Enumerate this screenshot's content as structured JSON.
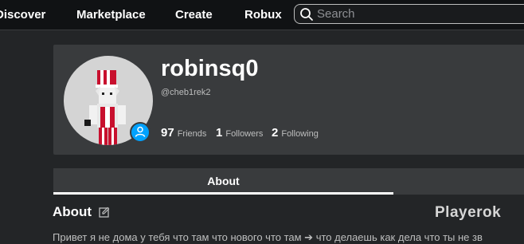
{
  "nav": {
    "discover": "Discover",
    "marketplace": "Marketplace",
    "create": "Create",
    "robux": "Robux"
  },
  "search": {
    "placeholder": "Search"
  },
  "profile": {
    "username": "robinsq0",
    "handle": "@cheb1rek2",
    "stats": [
      {
        "count": "97",
        "label": "Friends"
      },
      {
        "count": "1",
        "label": "Followers"
      },
      {
        "count": "2",
        "label": "Following"
      }
    ]
  },
  "tabs": {
    "about": "About"
  },
  "about": {
    "heading": "About",
    "text": "Привет я не дома у тебя что там что нового что там ➔ что делаешь как дела что ты не зв"
  },
  "watermark": "Playerok",
  "colors": {
    "background": "#232527",
    "card": "#393b3d",
    "topbar": "#101214",
    "accent": "#00a2ff"
  }
}
